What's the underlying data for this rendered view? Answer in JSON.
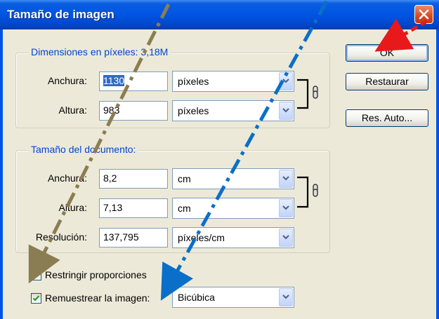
{
  "window": {
    "title": "Tamaño de imagen"
  },
  "pixel_dimensions": {
    "legend": "Dimensiones en píxeles: 3,18M",
    "width_label": "Anchura:",
    "width_value": "1130",
    "width_unit": "píxeles",
    "height_label": "Altura:",
    "height_value": "983",
    "height_unit": "píxeles"
  },
  "document_size": {
    "legend": "Tamaño del documento:",
    "width_label": "Anchura:",
    "width_value": "8,2",
    "width_unit": "cm",
    "height_label": "Altura:",
    "height_value": "7,13",
    "height_unit": "cm",
    "resolution_label": "Resolución:",
    "resolution_value": "137,795",
    "resolution_unit": "píxeles/cm"
  },
  "options": {
    "constrain_label": "Restringir proporciones",
    "constrain_checked": true,
    "resample_label": "Remuestrear la imagen:",
    "resample_checked": true,
    "resample_method": "Bicúbica"
  },
  "buttons": {
    "ok": "OK",
    "reset": "Restaurar",
    "auto": "Res. Auto..."
  },
  "colors": {
    "title_bar": "#0054e3",
    "legend_text": "#0046d5",
    "arrow_olive": "#8b7d52",
    "arrow_blue": "#0a6fc8",
    "arrow_red": "#e8191b"
  }
}
